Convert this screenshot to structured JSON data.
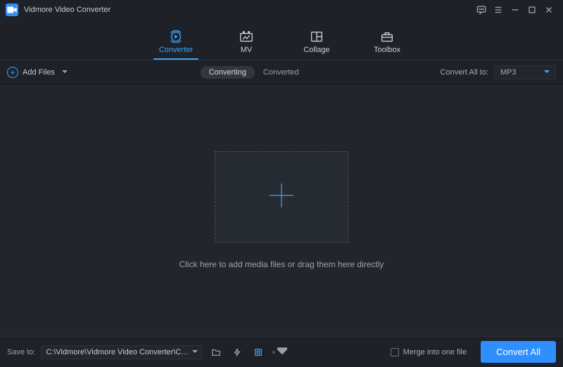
{
  "titlebar": {
    "app_title": "Vidmore Video Converter"
  },
  "topnav": {
    "items": [
      {
        "label": "Converter",
        "active": true
      },
      {
        "label": "MV"
      },
      {
        "label": "Collage"
      },
      {
        "label": "Toolbox"
      }
    ]
  },
  "toolbar": {
    "add_files_label": "Add Files",
    "seg": {
      "converting": "Converting",
      "converted": "Converted",
      "active": "converting"
    },
    "convert_all_to_label": "Convert All to:",
    "format_selected": "MP3"
  },
  "main": {
    "hint": "Click here to add media files or drag them here directly"
  },
  "bottombar": {
    "save_to_label": "Save to:",
    "path": "C:\\Vidmore\\Vidmore Video Converter\\Converted",
    "merge_label": "Merge into one file",
    "merge_checked": false,
    "convert_all_label": "Convert All"
  }
}
